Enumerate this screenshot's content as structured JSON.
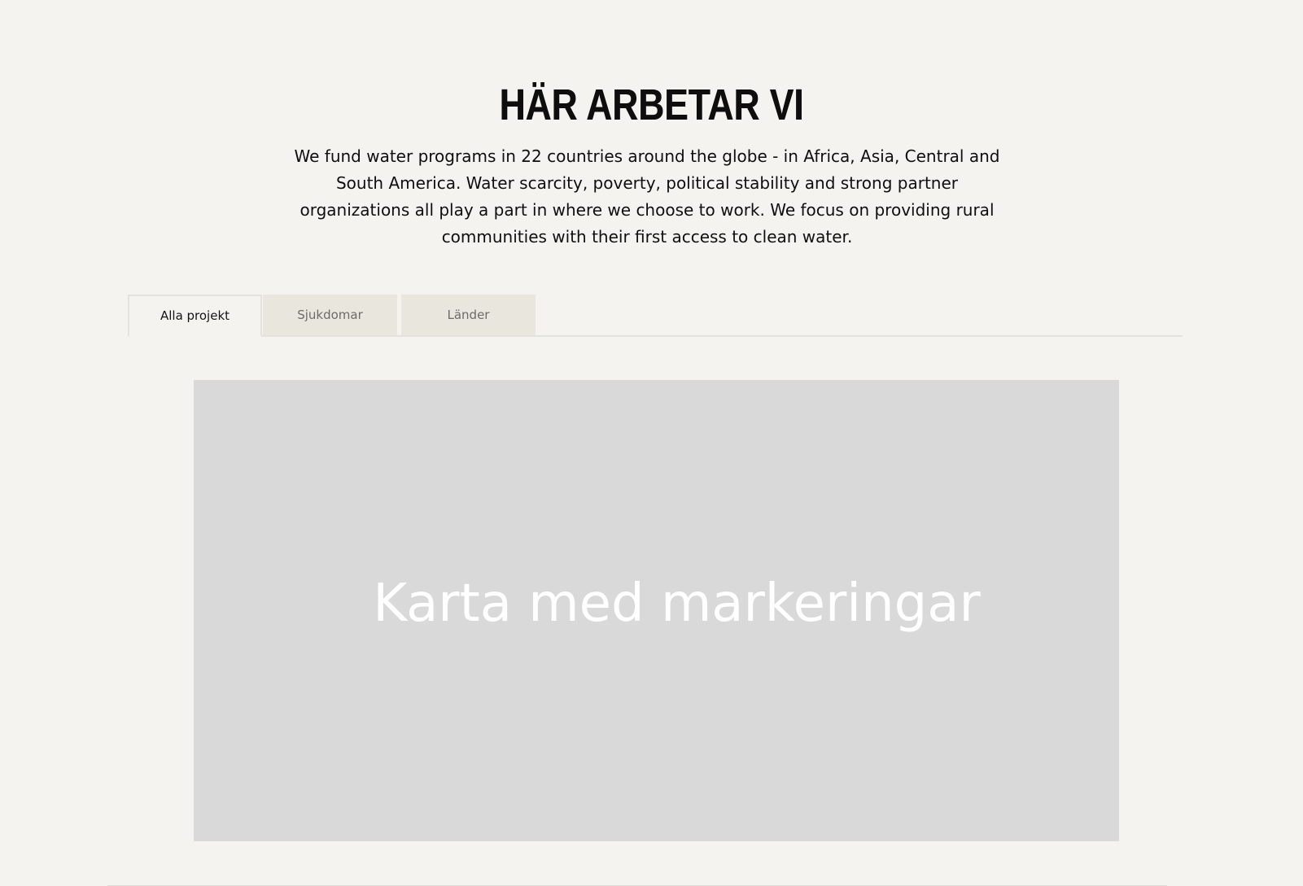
{
  "section": {
    "title": "HÄR ARBETAR VI",
    "intro": "We fund water programs in 22 countries around the globe - in Africa, Asia, Central and South America. Water scarcity, poverty, political stability and strong partner organizations all play a part in where we choose to work. We focus on providing rural communities with their first access to clean water."
  },
  "tabs": [
    {
      "label": "Alla projekt",
      "active": true
    },
    {
      "label": "Sjukdomar",
      "active": false
    },
    {
      "label": "Länder",
      "active": false
    }
  ],
  "map": {
    "placeholder": "Karta med markeringar"
  },
  "colors": {
    "background": "#f4f3ef",
    "tab_inactive": "#e9e6de",
    "map_placeholder": "#d9d9d9",
    "text": "#111111"
  }
}
